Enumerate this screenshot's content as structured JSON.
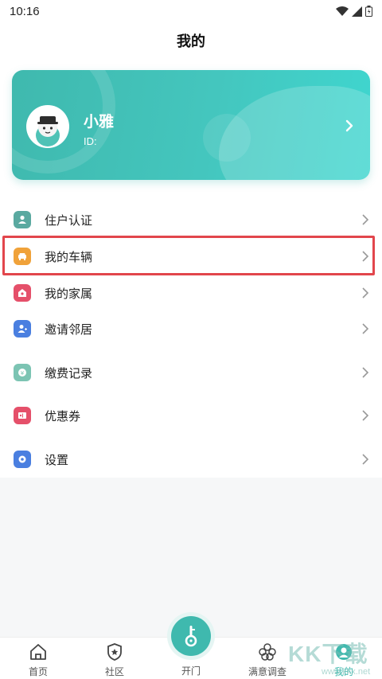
{
  "status_bar": {
    "time": "10:16"
  },
  "header": {
    "title": "我的"
  },
  "profile": {
    "name": "小雅",
    "id_label": "ID:"
  },
  "menu": [
    {
      "label": "住户认证",
      "icon": "resident-cert-icon",
      "color": "#5aa9a0"
    },
    {
      "label": "我的车辆",
      "icon": "car-icon",
      "color": "#f0a23a"
    },
    {
      "label": "我的家属",
      "icon": "family-icon",
      "color": "#e5506a"
    },
    {
      "label": "邀请邻居",
      "icon": "invite-neighbor-icon",
      "color": "#4a7fe0"
    },
    {
      "label": "缴费记录",
      "icon": "payment-record-icon",
      "color": "#7cc4b3"
    },
    {
      "label": "优惠券",
      "icon": "coupon-icon",
      "color": "#e5506a"
    },
    {
      "label": "设置",
      "icon": "settings-icon",
      "color": "#4a7fe0"
    }
  ],
  "tabs": [
    {
      "label": "首页",
      "icon": "home-icon"
    },
    {
      "label": "社区",
      "icon": "community-icon"
    },
    {
      "label": "开门",
      "icon": "key-icon"
    },
    {
      "label": "满意调查",
      "icon": "survey-icon"
    },
    {
      "label": "我的",
      "icon": "profile-icon",
      "active": true
    }
  ],
  "watermark": {
    "text": "KK下载",
    "sub": "www.kkx.net"
  },
  "colors": {
    "accent": "#3fb9ae",
    "highlight": "#e2464c"
  }
}
